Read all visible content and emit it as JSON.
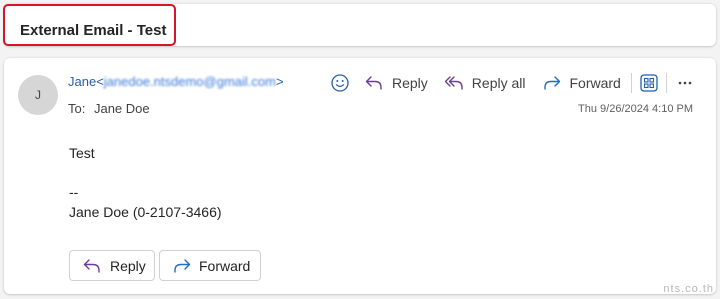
{
  "subject": {
    "title": "External Email - Test"
  },
  "message": {
    "avatar_initial": "J",
    "sender_name": "Jane",
    "sender_email_open": "<",
    "sender_email": "janedoe.ntsdemo@gmail.com",
    "sender_email_close": ">",
    "to_label": "To:",
    "to_name": "Jane Doe",
    "date": "Thu 9/26/2024 4:10 PM",
    "toolbar": {
      "reply_label": "Reply",
      "reply_all_label": "Reply all",
      "forward_label": "Forward"
    },
    "body": {
      "line1": "Test",
      "signature_separator": "--",
      "signature": "Jane Doe (0-2107-3466)"
    },
    "actions": {
      "reply_label": "Reply",
      "forward_label": "Forward"
    }
  },
  "watermark": "nts.co.th",
  "colors": {
    "highlight": "#d6142a",
    "link": "#2a5ea6",
    "reply_arrow": "#6b3d9a",
    "forward_arrow": "#1f6cc7"
  }
}
